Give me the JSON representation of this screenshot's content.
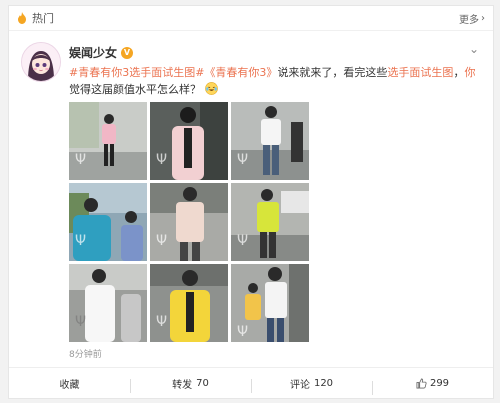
{
  "header": {
    "label": "热门",
    "more": "更多",
    "more_icon": "chevron-right-icon",
    "colors": {
      "fire": "#f5a623"
    }
  },
  "post": {
    "author": "娱闻少女",
    "badge": "V",
    "tag1": "#青春有你3选手面试生图#",
    "tag2": "《青春有你3》",
    "text_a": "说来就来了，看完这些",
    "hl1": "选手面试生图",
    "text_b": "，",
    "hl2": "你",
    "text_c": "觉得这届颜值水平怎么样？",
    "emoji_icon": "laughing-tears-emoji-icon",
    "time": "8分钟前",
    "photo_count": 9,
    "colors": {
      "link": "#eb7350",
      "badge": "#f5a623"
    }
  },
  "actions": {
    "favorite": "收藏",
    "repost_label": "转发",
    "repost_count": "70",
    "comment_label": "评论",
    "comment_count": "120",
    "like_count": "299"
  }
}
